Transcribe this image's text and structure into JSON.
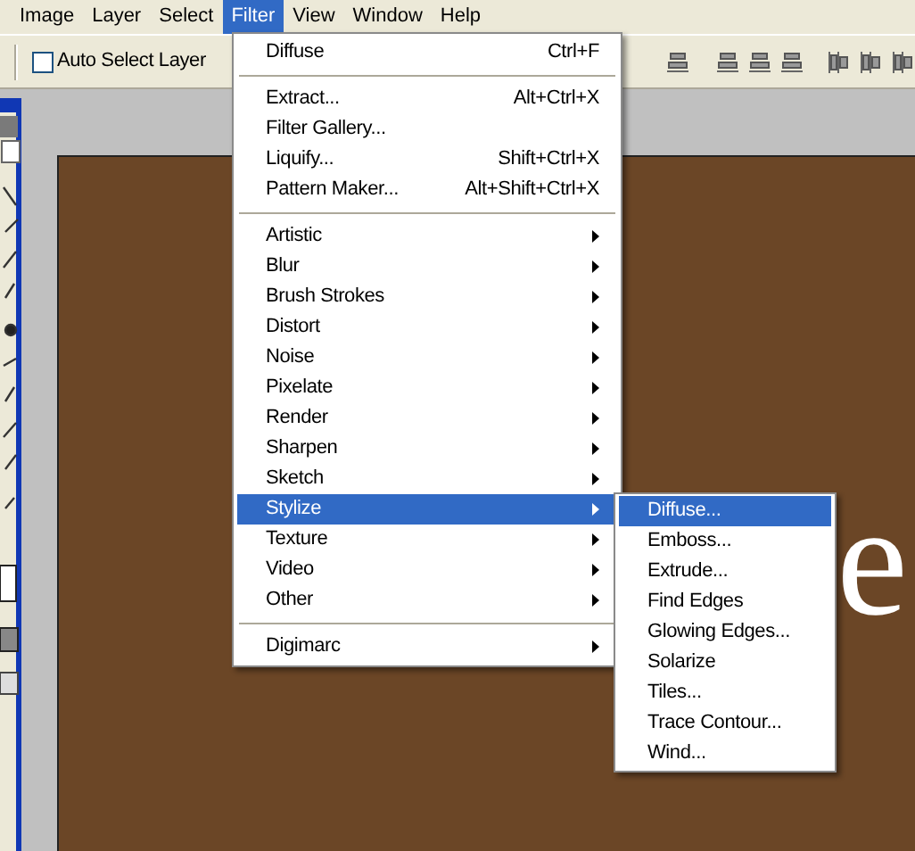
{
  "menu_bar": [
    {
      "label": "Image",
      "selected": false
    },
    {
      "label": "Layer",
      "selected": false
    },
    {
      "label": "Select",
      "selected": false
    },
    {
      "label": "Filter",
      "selected": true
    },
    {
      "label": "View",
      "selected": false
    },
    {
      "label": "Window",
      "selected": false
    },
    {
      "label": "Help",
      "selected": false
    }
  ],
  "options_bar": {
    "checkboxes": [
      {
        "label": "Auto Select Layer",
        "checked": false
      }
    ]
  },
  "canvas": {
    "text": "e"
  },
  "filter_menu": {
    "items": [
      {
        "kind": "item",
        "label": "Diffuse",
        "shortcut": "Ctrl+F",
        "selected": false
      },
      {
        "kind": "separator"
      },
      {
        "kind": "item",
        "label": "Extract...",
        "shortcut": "Alt+Ctrl+X",
        "selected": false
      },
      {
        "kind": "item",
        "label": "Filter Gallery...",
        "selected": false
      },
      {
        "kind": "item",
        "label": "Liquify...",
        "shortcut": "Shift+Ctrl+X",
        "selected": false
      },
      {
        "kind": "item",
        "label": "Pattern Maker...",
        "shortcut": "Alt+Shift+Ctrl+X",
        "selected": false
      },
      {
        "kind": "separator"
      },
      {
        "kind": "submenu",
        "label": "Artistic",
        "selected": false
      },
      {
        "kind": "submenu",
        "label": "Blur",
        "selected": false
      },
      {
        "kind": "submenu",
        "label": "Brush Strokes",
        "selected": false
      },
      {
        "kind": "submenu",
        "label": "Distort",
        "selected": false
      },
      {
        "kind": "submenu",
        "label": "Noise",
        "selected": false
      },
      {
        "kind": "submenu",
        "label": "Pixelate",
        "selected": false
      },
      {
        "kind": "submenu",
        "label": "Render",
        "selected": false
      },
      {
        "kind": "submenu",
        "label": "Sharpen",
        "selected": false
      },
      {
        "kind": "submenu",
        "label": "Sketch",
        "selected": false
      },
      {
        "kind": "submenu",
        "label": "Stylize",
        "selected": true
      },
      {
        "kind": "submenu",
        "label": "Texture",
        "selected": false
      },
      {
        "kind": "submenu",
        "label": "Video",
        "selected": false
      },
      {
        "kind": "submenu",
        "label": "Other",
        "selected": false
      },
      {
        "kind": "separator"
      },
      {
        "kind": "submenu",
        "label": "Digimarc",
        "selected": false
      }
    ]
  },
  "stylize_submenu": {
    "items": [
      {
        "label": "Diffuse...",
        "selected": true
      },
      {
        "label": "Emboss...",
        "selected": false
      },
      {
        "label": "Extrude...",
        "selected": false
      },
      {
        "label": "Find Edges",
        "selected": false
      },
      {
        "label": "Glowing Edges...",
        "selected": false
      },
      {
        "label": "Solarize",
        "selected": false
      },
      {
        "label": "Tiles...",
        "selected": false
      },
      {
        "label": "Trace Contour...",
        "selected": false
      },
      {
        "label": "Wind...",
        "selected": false
      }
    ]
  }
}
